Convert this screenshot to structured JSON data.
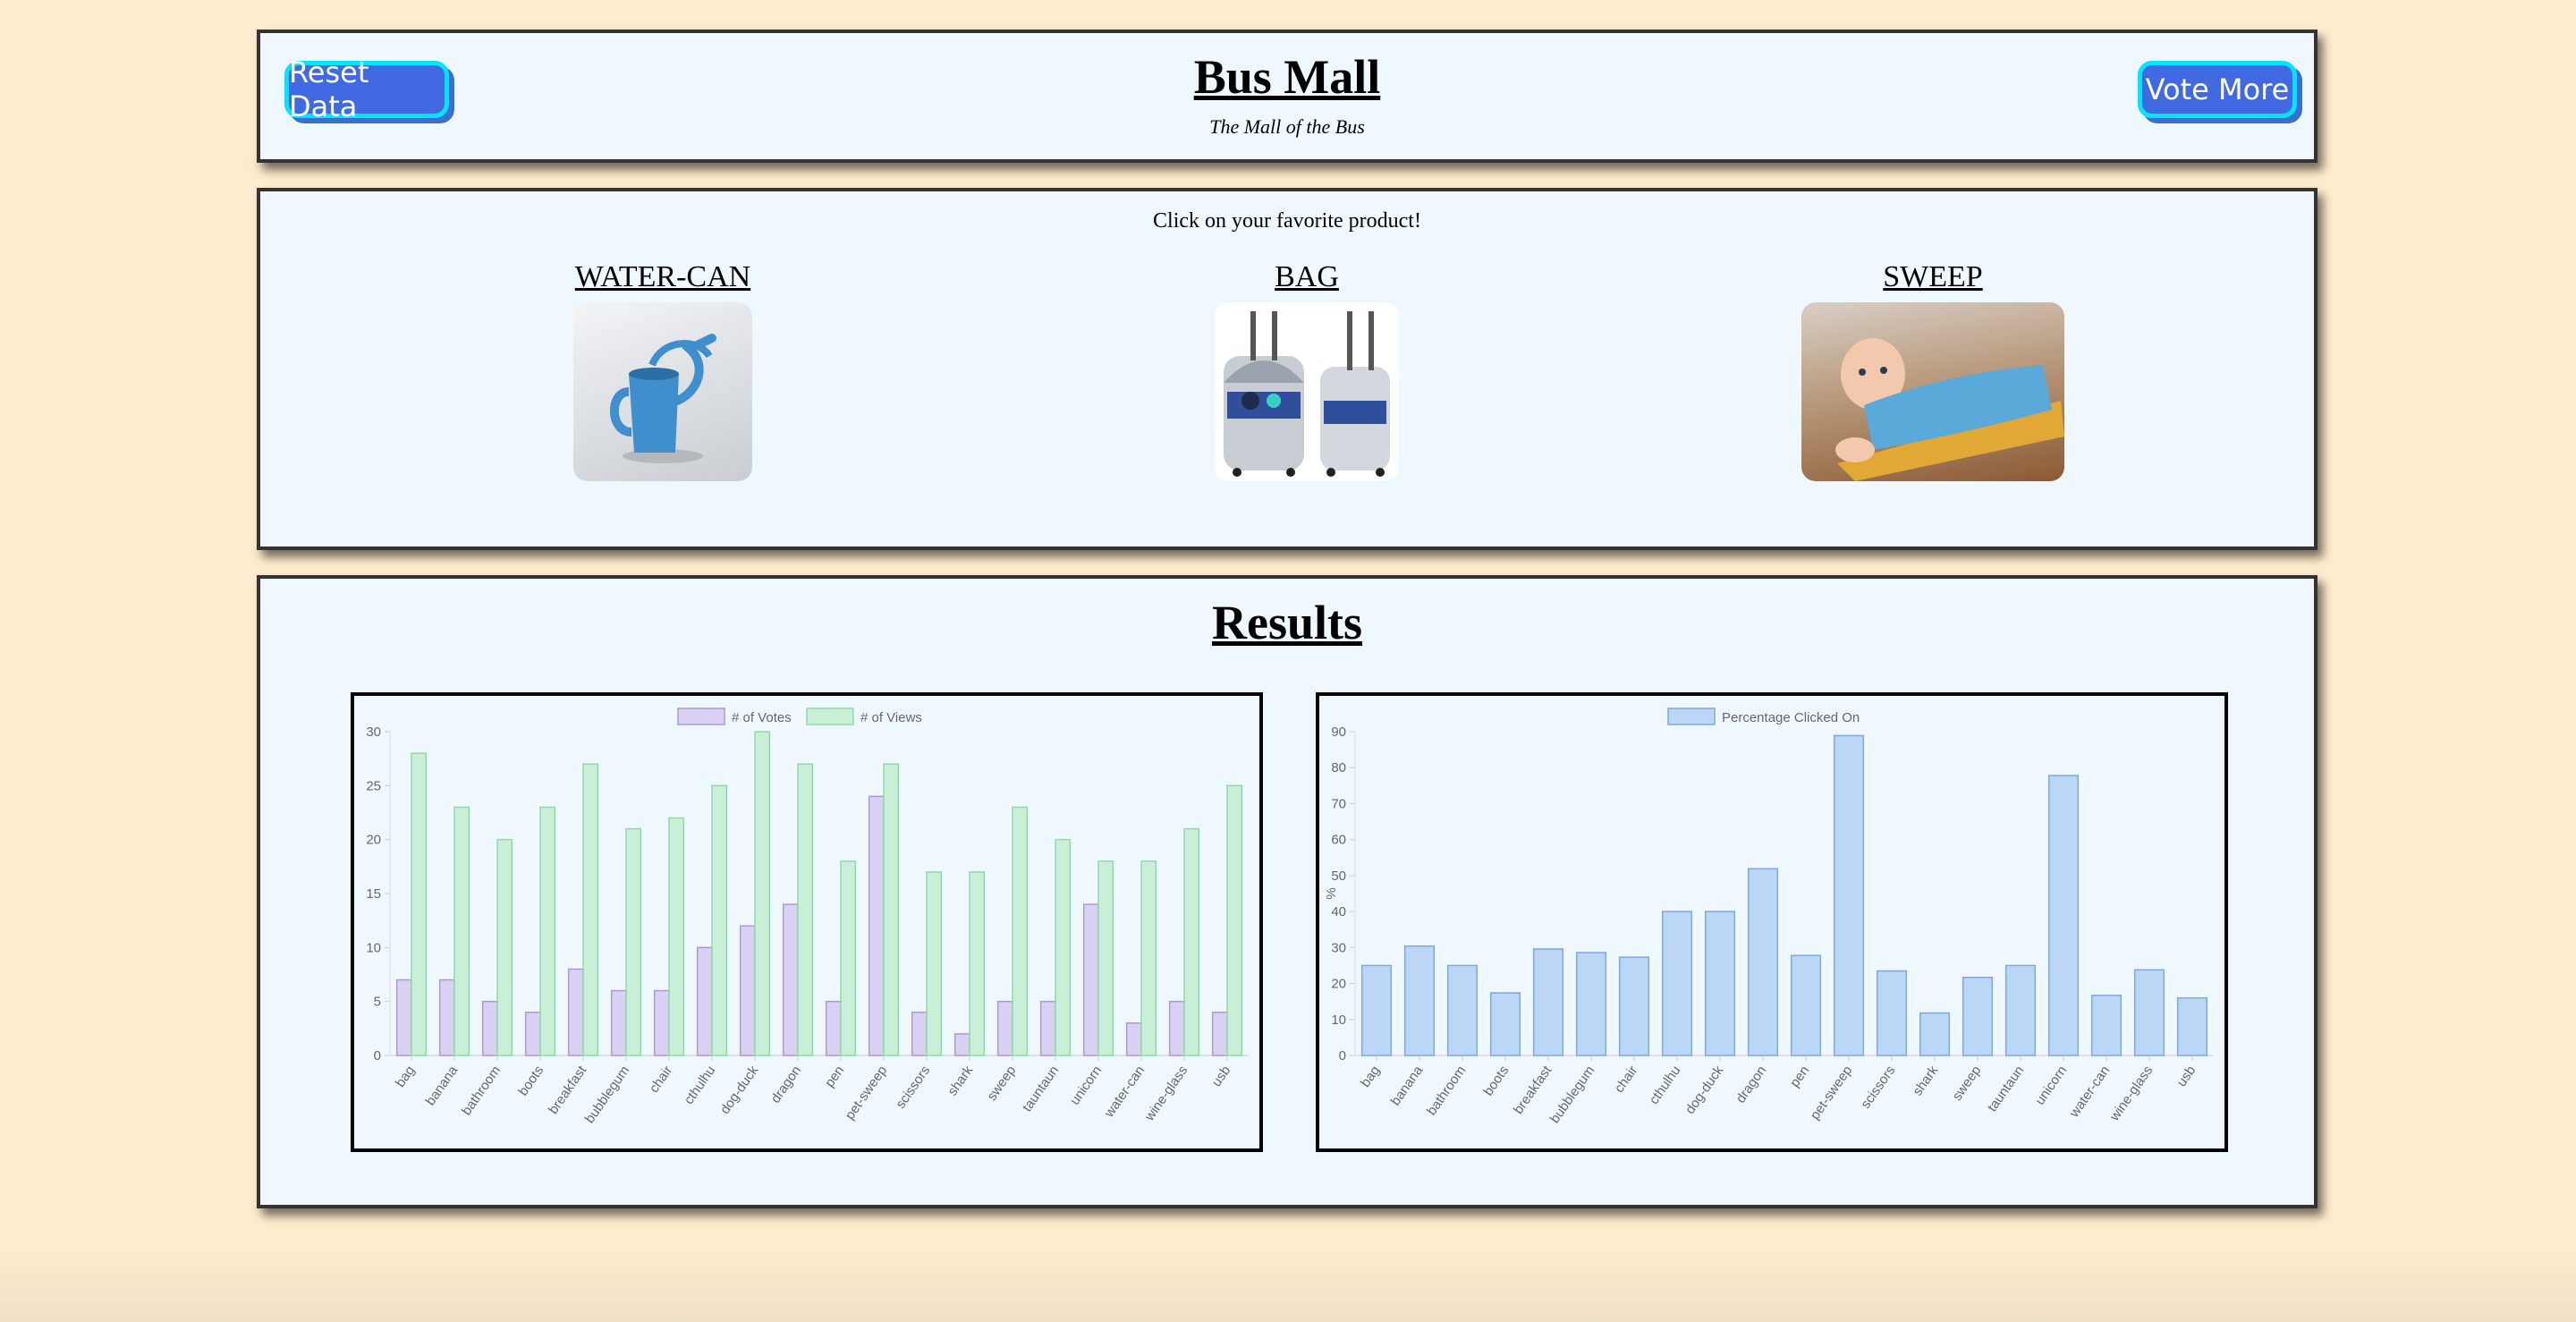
{
  "header": {
    "title": "Bus Mall",
    "subtitle": "The Mall of the Bus",
    "reset_label": "Reset Data",
    "vote_label": "Vote More"
  },
  "voting": {
    "instruction": "Click on your favorite product!",
    "products": [
      {
        "name": "WATER-CAN",
        "icon": "watering-can-image"
      },
      {
        "name": "BAG",
        "icon": "r2d2-luggage-image"
      },
      {
        "name": "SWEEP",
        "icon": "baby-sweeper-onesie-image"
      }
    ]
  },
  "results": {
    "title": "Results"
  },
  "colors": {
    "votes_fill": "#d9d1f2",
    "votes_border": "#a999d6",
    "views_fill": "#c9f0d6",
    "views_border": "#8edba8",
    "pct_fill": "#bcd6f5",
    "pct_border": "#7ea8e0"
  },
  "chart_data": [
    {
      "type": "bar",
      "categories": [
        "bag",
        "banana",
        "bathroom",
        "boots",
        "breakfast",
        "bubblegum",
        "chair",
        "cthulhu",
        "dog-duck",
        "dragon",
        "pen",
        "pet-sweep",
        "scissors",
        "shark",
        "sweep",
        "tauntaun",
        "unicorn",
        "water-can",
        "wine-glass",
        "usb"
      ],
      "series": [
        {
          "name": "# of Votes",
          "values": [
            7,
            7,
            5,
            4,
            8,
            6,
            6,
            10,
            12,
            14,
            5,
            24,
            4,
            2,
            5,
            5,
            14,
            3,
            5,
            4
          ]
        },
        {
          "name": "# of Views",
          "values": [
            28,
            23,
            20,
            23,
            27,
            21,
            22,
            25,
            30,
            27,
            18,
            27,
            17,
            17,
            23,
            20,
            18,
            18,
            21,
            25
          ]
        }
      ],
      "ylim": [
        0,
        30
      ],
      "yticks": [
        0,
        5,
        10,
        15,
        20,
        25,
        30
      ],
      "legend": "top-center",
      "xlabel": "",
      "ylabel": ""
    },
    {
      "type": "bar",
      "categories": [
        "bag",
        "banana",
        "bathroom",
        "boots",
        "breakfast",
        "bubblegum",
        "chair",
        "cthulhu",
        "dog-duck",
        "dragon",
        "pen",
        "pet-sweep",
        "scissors",
        "shark",
        "sweep",
        "tauntaun",
        "unicorn",
        "water-can",
        "wine-glass",
        "usb"
      ],
      "series": [
        {
          "name": "Percentage Clicked On",
          "values": [
            25,
            30.4,
            25,
            17.4,
            29.6,
            28.6,
            27.3,
            40,
            40,
            51.9,
            27.8,
            88.9,
            23.5,
            11.8,
            21.7,
            25,
            77.8,
            16.7,
            23.8,
            16
          ]
        }
      ],
      "ylim": [
        0,
        90
      ],
      "yticks": [
        0,
        10,
        20,
        30,
        40,
        50,
        60,
        70,
        80,
        90
      ],
      "legend": "top-center",
      "xlabel": "",
      "ylabel": "%"
    }
  ]
}
